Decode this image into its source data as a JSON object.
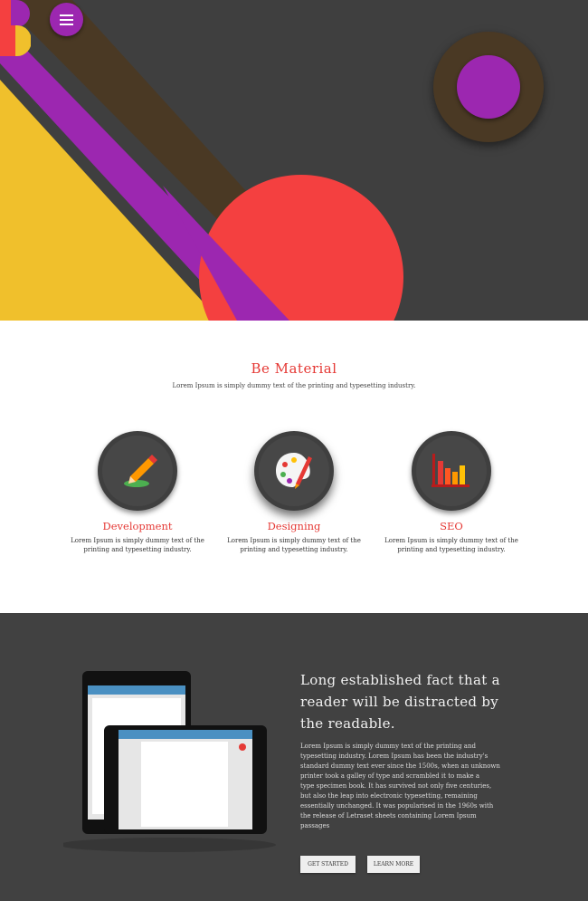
{
  "header": {
    "menu_icon": "hamburger-menu-icon",
    "logo_letter": "B",
    "colors": {
      "background": "#3f3f3f",
      "purple": "#9c27b0",
      "yellow": "#f0c02c",
      "brown": "#4a3924",
      "red": "#f44040"
    }
  },
  "intro": {
    "title": "Be Material",
    "subtitle": "Lorem Ipsum is simply dummy text of the printing and typesetting industry."
  },
  "features": [
    {
      "icon": "pencil-icon",
      "title": "Development",
      "desc_line1": "Lorem Ipsum is simply dummy text of the",
      "desc_line2": "printing and typesetting industry."
    },
    {
      "icon": "palette-icon",
      "title": "Designing",
      "desc_line1": "Lorem Ipsum is simply dummy text of the",
      "desc_line2": "printing and typesetting industry."
    },
    {
      "icon": "bar-chart-icon",
      "title": "SEO",
      "desc_line1": "Lorem Ipsum is simply dummy text of the",
      "desc_line2": "printing and typesetting industry."
    }
  ],
  "about": {
    "heading_line1": "Long established fact that a",
    "heading_line2": "reader will be distracted by",
    "heading_line3": "the readable.",
    "body": [
      "Lorem Ipsum is simply dummy text of the printing and",
      "typesetting industry. Lorem Ipsum has been the industry's",
      "standard dummy text ever since the 1500s, when an unknown",
      "printer took a galley of type and scrambled it to make a",
      "type specimen book. It has survived not only five centuries,",
      "but also the leap into electronic typesetting, remaining",
      "essentially unchanged. It was popularised in the 1960s with",
      "the release of Letraset sheets containing Lorem Ipsum",
      "passages"
    ],
    "get_started": "GET STARTED",
    "learn_more": "LEARN MORE"
  }
}
